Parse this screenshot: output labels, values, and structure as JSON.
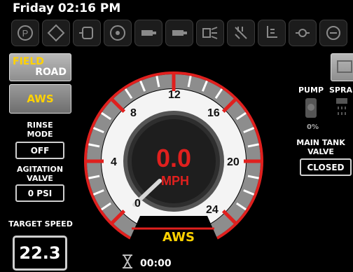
{
  "header": {
    "datetime": "Friday 02:16 PM"
  },
  "icon_bar": [
    {
      "name": "parking-brake-icon"
    },
    {
      "name": "steer-mode-icon"
    },
    {
      "name": "tank-icon"
    },
    {
      "name": "fan-icon"
    },
    {
      "name": "cylinder-icon"
    },
    {
      "name": "cylinder-icon-2"
    },
    {
      "name": "nozzle-icon"
    },
    {
      "name": "spray-off-icon"
    },
    {
      "name": "boom-icon"
    },
    {
      "name": "valve-icon"
    },
    {
      "name": "pump-icon"
    }
  ],
  "left_panel": {
    "field_button": {
      "line1": "FIELD",
      "line2": "ROAD"
    },
    "aws_button": "AWS",
    "rinse_mode": {
      "label_line1": "RINSE",
      "label_line2": "MODE",
      "value": "OFF"
    },
    "agitation_valve": {
      "label_line1": "AGITATION",
      "label_line2": "VALVE",
      "value": "0 PSI"
    },
    "target_speed": {
      "label": "TARGET SPEED",
      "value": "22.3"
    }
  },
  "gauge": {
    "speed_value": "0.0",
    "unit": "MPH",
    "ticks": [
      "0",
      "4",
      "8",
      "12",
      "16",
      "20",
      "24"
    ],
    "min": 0,
    "max": 24,
    "needle_value": 0,
    "mode_label": "AWS"
  },
  "right_panel": {
    "pump_label": "PUMP",
    "spray_label": "SPRA",
    "pump_percent": "0%",
    "main_tank_valve": {
      "label_line1": "MAIN TANK",
      "label_line2": "VALVE",
      "value": "CLOSED"
    }
  },
  "footer": {
    "timer": "00:00"
  },
  "colors": {
    "accent": "#ffd200",
    "gauge_red": "#e0201e"
  }
}
